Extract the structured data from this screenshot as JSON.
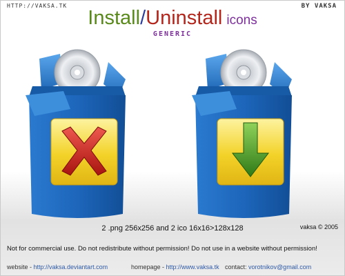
{
  "header": {
    "site": "HTTP://VAKSA.TK",
    "author": "BY VAKSA"
  },
  "title": {
    "word1": "Install",
    "slash": "/",
    "word2": "Uninstall",
    "word3": "icons",
    "subtitle": "GENERIC"
  },
  "icons": [
    {
      "name": "uninstall",
      "symbol": "red-x-icon",
      "accent": "#c8201a"
    },
    {
      "name": "install",
      "symbol": "green-down-arrow-icon",
      "accent": "#4f9e25"
    }
  ],
  "colors": {
    "box_blue": "#1f6cc0",
    "panel_yellow": "#f3d228"
  },
  "specs": "2 .png 256x256 and 2 ico 16x16>128x128",
  "copyright": "vaksa © 2005",
  "notice": "Not for commercial use. Do not redistribute without permission! Do not use in a website without permission!",
  "footer": {
    "website_label": "website - ",
    "website_url": "http://vaksa.deviantart.com",
    "homepage_label": "homepage - ",
    "homepage_url": "http://www.vaksa.tk",
    "contact_label": "contact: ",
    "contact_email": "vorotnikov@gmail.com"
  }
}
